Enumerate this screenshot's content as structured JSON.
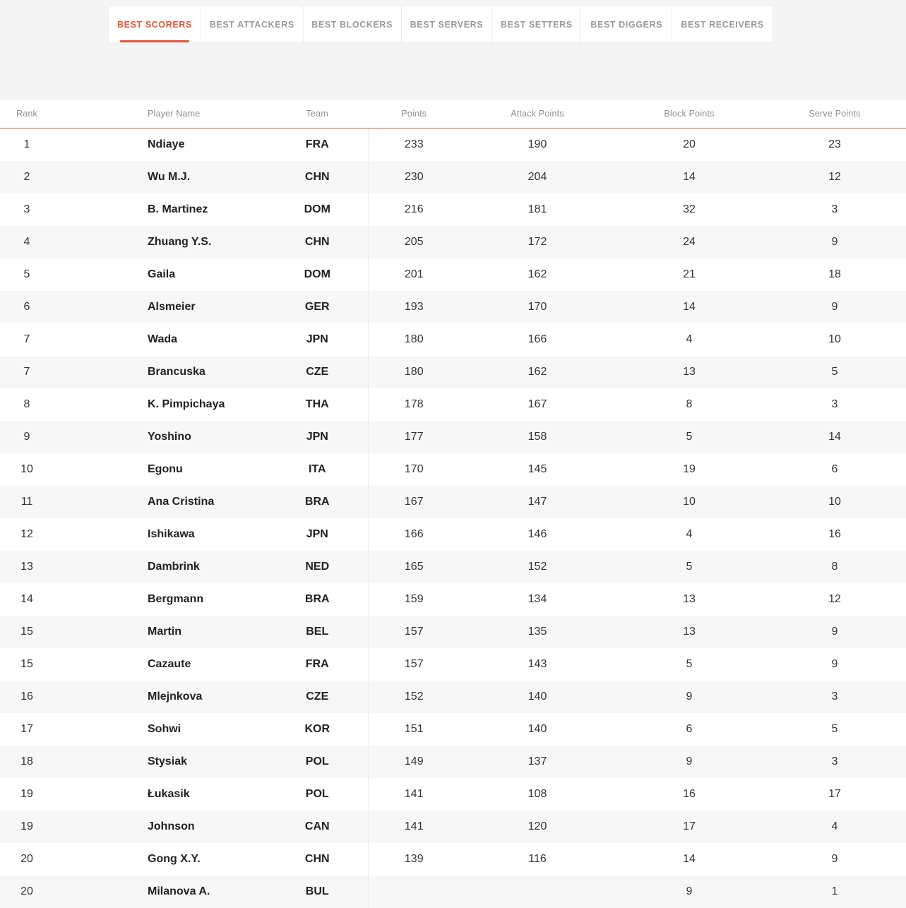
{
  "tabs": [
    {
      "label": "BEST SCORERS",
      "active": true
    },
    {
      "label": "BEST ATTACKERS",
      "active": false
    },
    {
      "label": "BEST BLOCKERS",
      "active": false
    },
    {
      "label": "BEST SERVERS",
      "active": false
    },
    {
      "label": "BEST SETTERS",
      "active": false
    },
    {
      "label": "BEST DIGGERS",
      "active": false
    },
    {
      "label": "BEST RECEIVERS",
      "active": false
    }
  ],
  "table": {
    "columns": [
      "Rank",
      "Player Name",
      "Team",
      "Points",
      "Attack Points",
      "Block Points",
      "Serve Points"
    ],
    "rows": [
      [
        "1",
        "Ndiaye",
        "FRA",
        "233",
        "190",
        "20",
        "23"
      ],
      [
        "2",
        "Wu M.J.",
        "CHN",
        "230",
        "204",
        "14",
        "12"
      ],
      [
        "3",
        "B. Martinez",
        "DOM",
        "216",
        "181",
        "32",
        "3"
      ],
      [
        "4",
        "Zhuang Y.S.",
        "CHN",
        "205",
        "172",
        "24",
        "9"
      ],
      [
        "5",
        "Gaila",
        "DOM",
        "201",
        "162",
        "21",
        "18"
      ],
      [
        "6",
        "Alsmeier",
        "GER",
        "193",
        "170",
        "14",
        "9"
      ],
      [
        "7",
        "Wada",
        "JPN",
        "180",
        "166",
        "4",
        "10"
      ],
      [
        "7",
        "Brancuska",
        "CZE",
        "180",
        "162",
        "13",
        "5"
      ],
      [
        "8",
        "K. Pimpichaya",
        "THA",
        "178",
        "167",
        "8",
        "3"
      ],
      [
        "9",
        "Yoshino",
        "JPN",
        "177",
        "158",
        "5",
        "14"
      ],
      [
        "10",
        "Egonu",
        "ITA",
        "170",
        "145",
        "19",
        "6"
      ],
      [
        "11",
        "Ana Cristina",
        "BRA",
        "167",
        "147",
        "10",
        "10"
      ],
      [
        "12",
        "Ishikawa",
        "JPN",
        "166",
        "146",
        "4",
        "16"
      ],
      [
        "13",
        "Dambrink",
        "NED",
        "165",
        "152",
        "5",
        "8"
      ],
      [
        "14",
        "Bergmann",
        "BRA",
        "159",
        "134",
        "13",
        "12"
      ],
      [
        "15",
        "Martin",
        "BEL",
        "157",
        "135",
        "13",
        "9"
      ],
      [
        "15",
        "Cazaute",
        "FRA",
        "157",
        "143",
        "5",
        "9"
      ],
      [
        "16",
        "Mlejnkova",
        "CZE",
        "152",
        "140",
        "9",
        "3"
      ],
      [
        "17",
        "Sohwi",
        "KOR",
        "151",
        "140",
        "6",
        "5"
      ],
      [
        "18",
        "Stysiak",
        "POL",
        "149",
        "137",
        "9",
        "3"
      ],
      [
        "19",
        "Łukasik",
        "POL",
        "141",
        "108",
        "16",
        "17"
      ],
      [
        "19",
        "Johnson",
        "CAN",
        "141",
        "120",
        "17",
        "4"
      ],
      [
        "20",
        "Gong X.Y.",
        "CHN",
        "139",
        "116",
        "14",
        "9"
      ],
      [
        "20",
        "Milanova A.",
        "BUL",
        "",
        "",
        "9",
        "1"
      ]
    ]
  },
  "colors": {
    "accent": "#e4553a",
    "band": "#f4f4f4",
    "row_alt": "#f7f7f7"
  }
}
